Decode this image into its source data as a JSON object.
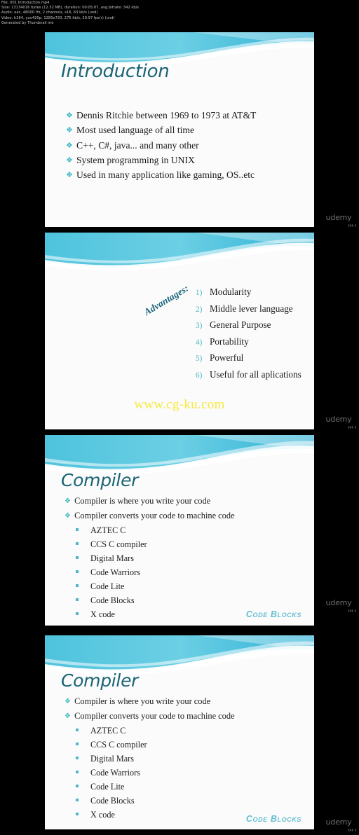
{
  "meta": {
    "line1": "File: 001 Introduction.mp4",
    "line2": "Size: 13134016 bytes (12.52 MB), duration: 00:05:07, avg.bitrate: 342 kb/s",
    "line3": "Audio: aac, 48000 Hz, 2 channels, s16, 63 kb/s (und)",
    "line4": "Video: h264, yuv420p, 1280x720, 275 kb/s, 29.97 fps(r) (und)",
    "line5": "Generated by Thumbnail me"
  },
  "colors": {
    "title_teal": "#1a6475",
    "bullet_teal": "#39b8c4",
    "wave_cyan": "#5cc6de",
    "watermark_yellow": "#f5ea40",
    "background": "#000000",
    "slide_bg": "#fbfbfb"
  },
  "slides": [
    {
      "title": "Introduction",
      "bullets": [
        "Dennis Ritchie between 1969 to 1973 at AT&T",
        "Most used language of all time",
        "C++, C#, java... and many other",
        "System programming in UNIX",
        "Used in many application like gaming, OS..etc"
      ]
    },
    {
      "label": "Advantages:",
      "items": [
        {
          "num": "1)",
          "text": "Modularity"
        },
        {
          "num": "2)",
          "text": "Middle lever language"
        },
        {
          "num": "3)",
          "text": "General Purpose"
        },
        {
          "num": "4)",
          "text": "Portability"
        },
        {
          "num": "5)",
          "text": "Powerful"
        },
        {
          "num": "6)",
          "text": "Useful for all aplications"
        }
      ],
      "url": "www.cg-ku.com"
    },
    {
      "title": "Compiler",
      "bullets": [
        "Compiler  is where you write your code",
        "Compiler  converts  your code to machine code"
      ],
      "sublist": [
        "AZTEC C",
        "CCS C compiler",
        "Digital Mars",
        "Code Warriors",
        "Code Lite",
        "Code Blocks",
        "X code"
      ],
      "footer": "Code Blocks"
    },
    {
      "title": "Compiler",
      "bullets": [
        "Compiler  is where you write your code",
        "Compiler  converts  your code to machine code"
      ],
      "sublist": [
        "AZTEC C",
        "CCS C compiler",
        "Digital Mars",
        "Code Warriors",
        "Code Lite",
        "Code Blocks",
        "X code"
      ],
      "footer": "Code Blocks"
    }
  ],
  "watermark": {
    "brand": "udemy",
    "sub": "▮▮▮ ▮"
  }
}
